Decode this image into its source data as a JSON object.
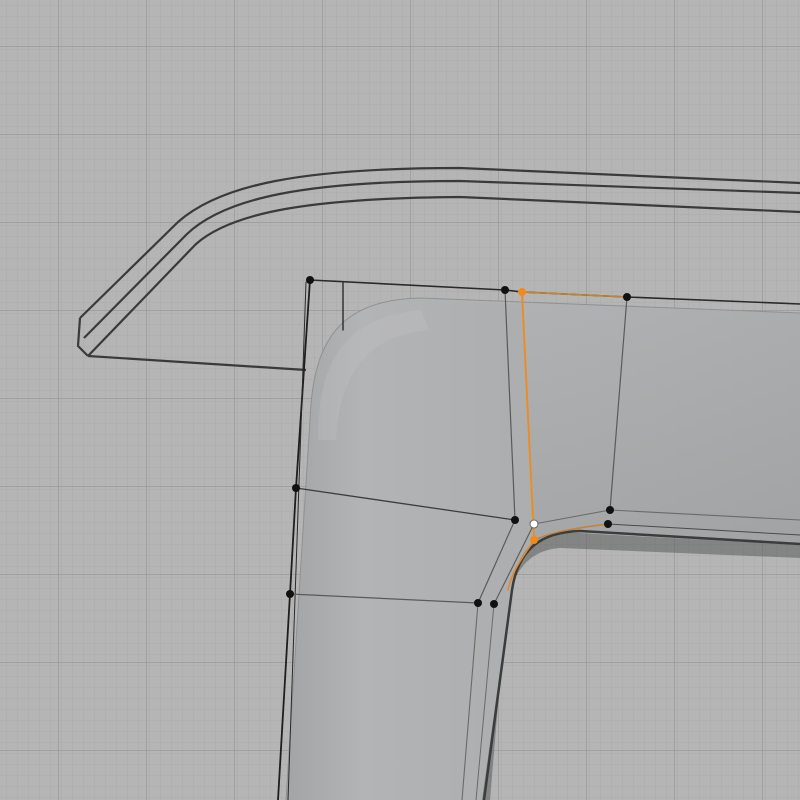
{
  "viewport": {
    "view": "3d-modeling-viewport",
    "background_color": "#b5b5b5",
    "grid_minor_color": "#a9a9a9",
    "grid_major_color": "#9c9c9c",
    "grid_visible": true
  },
  "mesh": {
    "surface_color": "#a7a9aa",
    "surface_highlight_color": "#bcbcbc",
    "wireframe_color": "#2a2a2a",
    "cage_edge_color": "#5a5a5a",
    "selection_color": "#f08a1c",
    "active_vertex_color": "#ffffff",
    "selected_edge": true,
    "selected_vertices": 2,
    "active_vertices": 1
  },
  "background_object": {
    "type": "wireframe-profile",
    "line_color": "#3a3a3a"
  }
}
